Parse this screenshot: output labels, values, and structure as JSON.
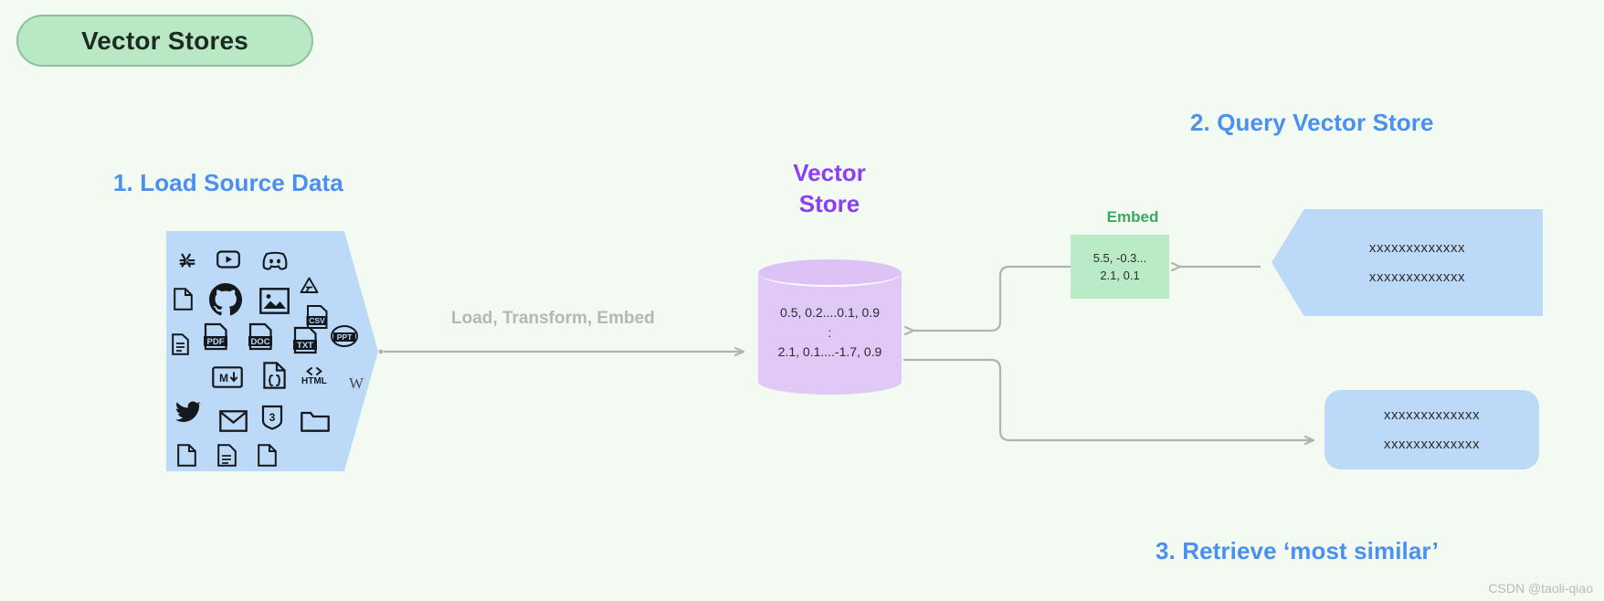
{
  "page": {
    "background": "#f2faf2",
    "watermark": "CSDN @taoli-qiao"
  },
  "title_badge": {
    "label": "Vector Stores",
    "fill": "#b8e9c4",
    "border": "#8fbf9c"
  },
  "headings": {
    "load": "1. Load Source Data",
    "query": "2. Query Vector Store",
    "retrieve": "3. Retrieve ‘most similar’",
    "color": "#4a90f0"
  },
  "source": {
    "shape": "pentagon-arrow-right",
    "fill": "#bcd9f7",
    "icons": [
      "slack-icon",
      "youtube-icon",
      "discord-icon",
      "file-blank-icon",
      "github-icon",
      "image-icon",
      "google-drive-icon",
      "csv-file-icon",
      "document-lines-icon",
      "pdf-file-icon",
      "doc-file-icon",
      "txt-file-icon",
      "ppt-file-icon",
      "markdown-icon",
      "json-code-file-icon",
      "html-icon",
      "wikipedia-icon",
      "twitter-icon",
      "email-icon",
      "css3-icon",
      "folder-icon",
      "file-page-icon",
      "file-text-icon",
      "file-corner-icon"
    ]
  },
  "pipeline": {
    "load_label": "Load, Transform, Embed",
    "label_color": "#b4b8b4",
    "arrow_color": "#b0b4b0"
  },
  "vector_store": {
    "title_line1": "Vector",
    "title_line2": "Store",
    "title_color": "#8b3ef5",
    "fill": "#e0c9f7",
    "rows": [
      "0.5, 0.2....0.1, 0.9",
      ":",
      "2.1, 0.1....-1.7, 0.9"
    ]
  },
  "embed": {
    "label": "Embed",
    "label_color": "#3aa862",
    "fill": "#b9ecc6",
    "rows": [
      "5.5, -0.3...",
      "2.1, 0.1"
    ]
  },
  "query": {
    "fill": "#bcd9f7",
    "rows": [
      "xxxxxxxxxxxxx",
      "xxxxxxxxxxxxx"
    ]
  },
  "result": {
    "fill": "#bcd9f7",
    "rows": [
      "xxxxxxxxxxxxx",
      "xxxxxxxxxxxxx"
    ]
  }
}
